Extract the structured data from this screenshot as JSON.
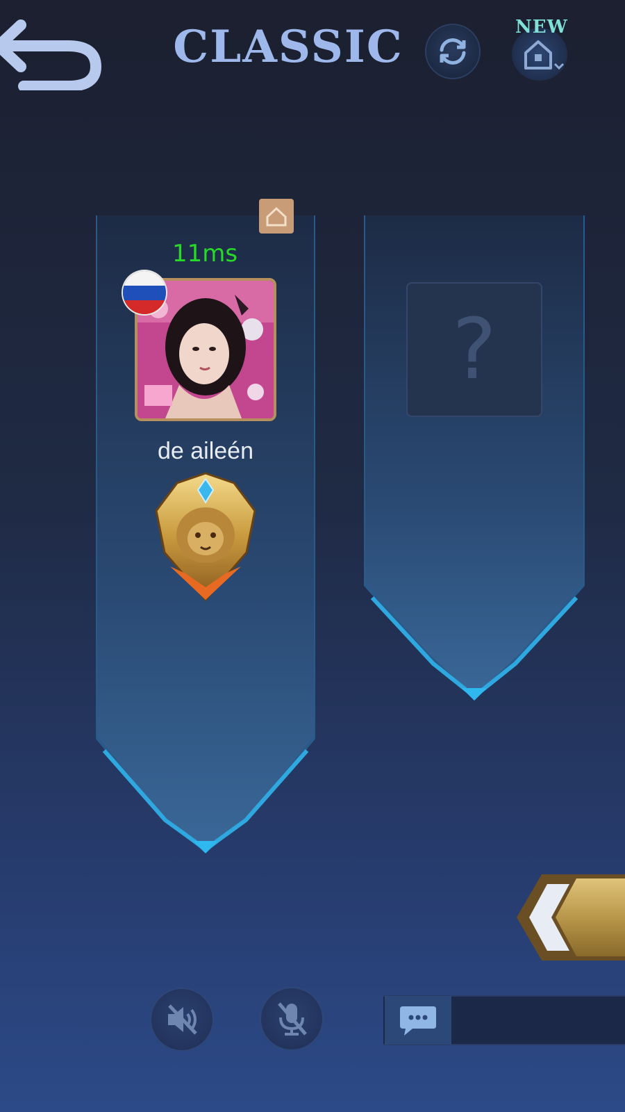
{
  "header": {
    "title": "CLASSIC",
    "new_badge": "NEW",
    "icons": {
      "back": "back-arrow-icon",
      "refresh": "refresh-icon",
      "home": "home-icon"
    }
  },
  "slots": [
    {
      "ping": "11ms",
      "name": "de aileén",
      "flag": "russia-flag-icon",
      "rank": "mythic-lion-badge-icon",
      "home_tag": "home-icon"
    },
    {
      "empty_mark": "?"
    }
  ],
  "controls": {
    "speaker": "speaker-muted-icon",
    "mic": "mic-muted-icon",
    "chat": "chat-bubble-icon",
    "start": "start-match-button"
  },
  "colors": {
    "title": "#9eb8ec",
    "ping": "#29d92a",
    "new_badge": "#7fe0d8",
    "avatar_border": "#b58f5e",
    "banner_edge": "#2fa8e0",
    "start_gold": "#c2a25a"
  }
}
